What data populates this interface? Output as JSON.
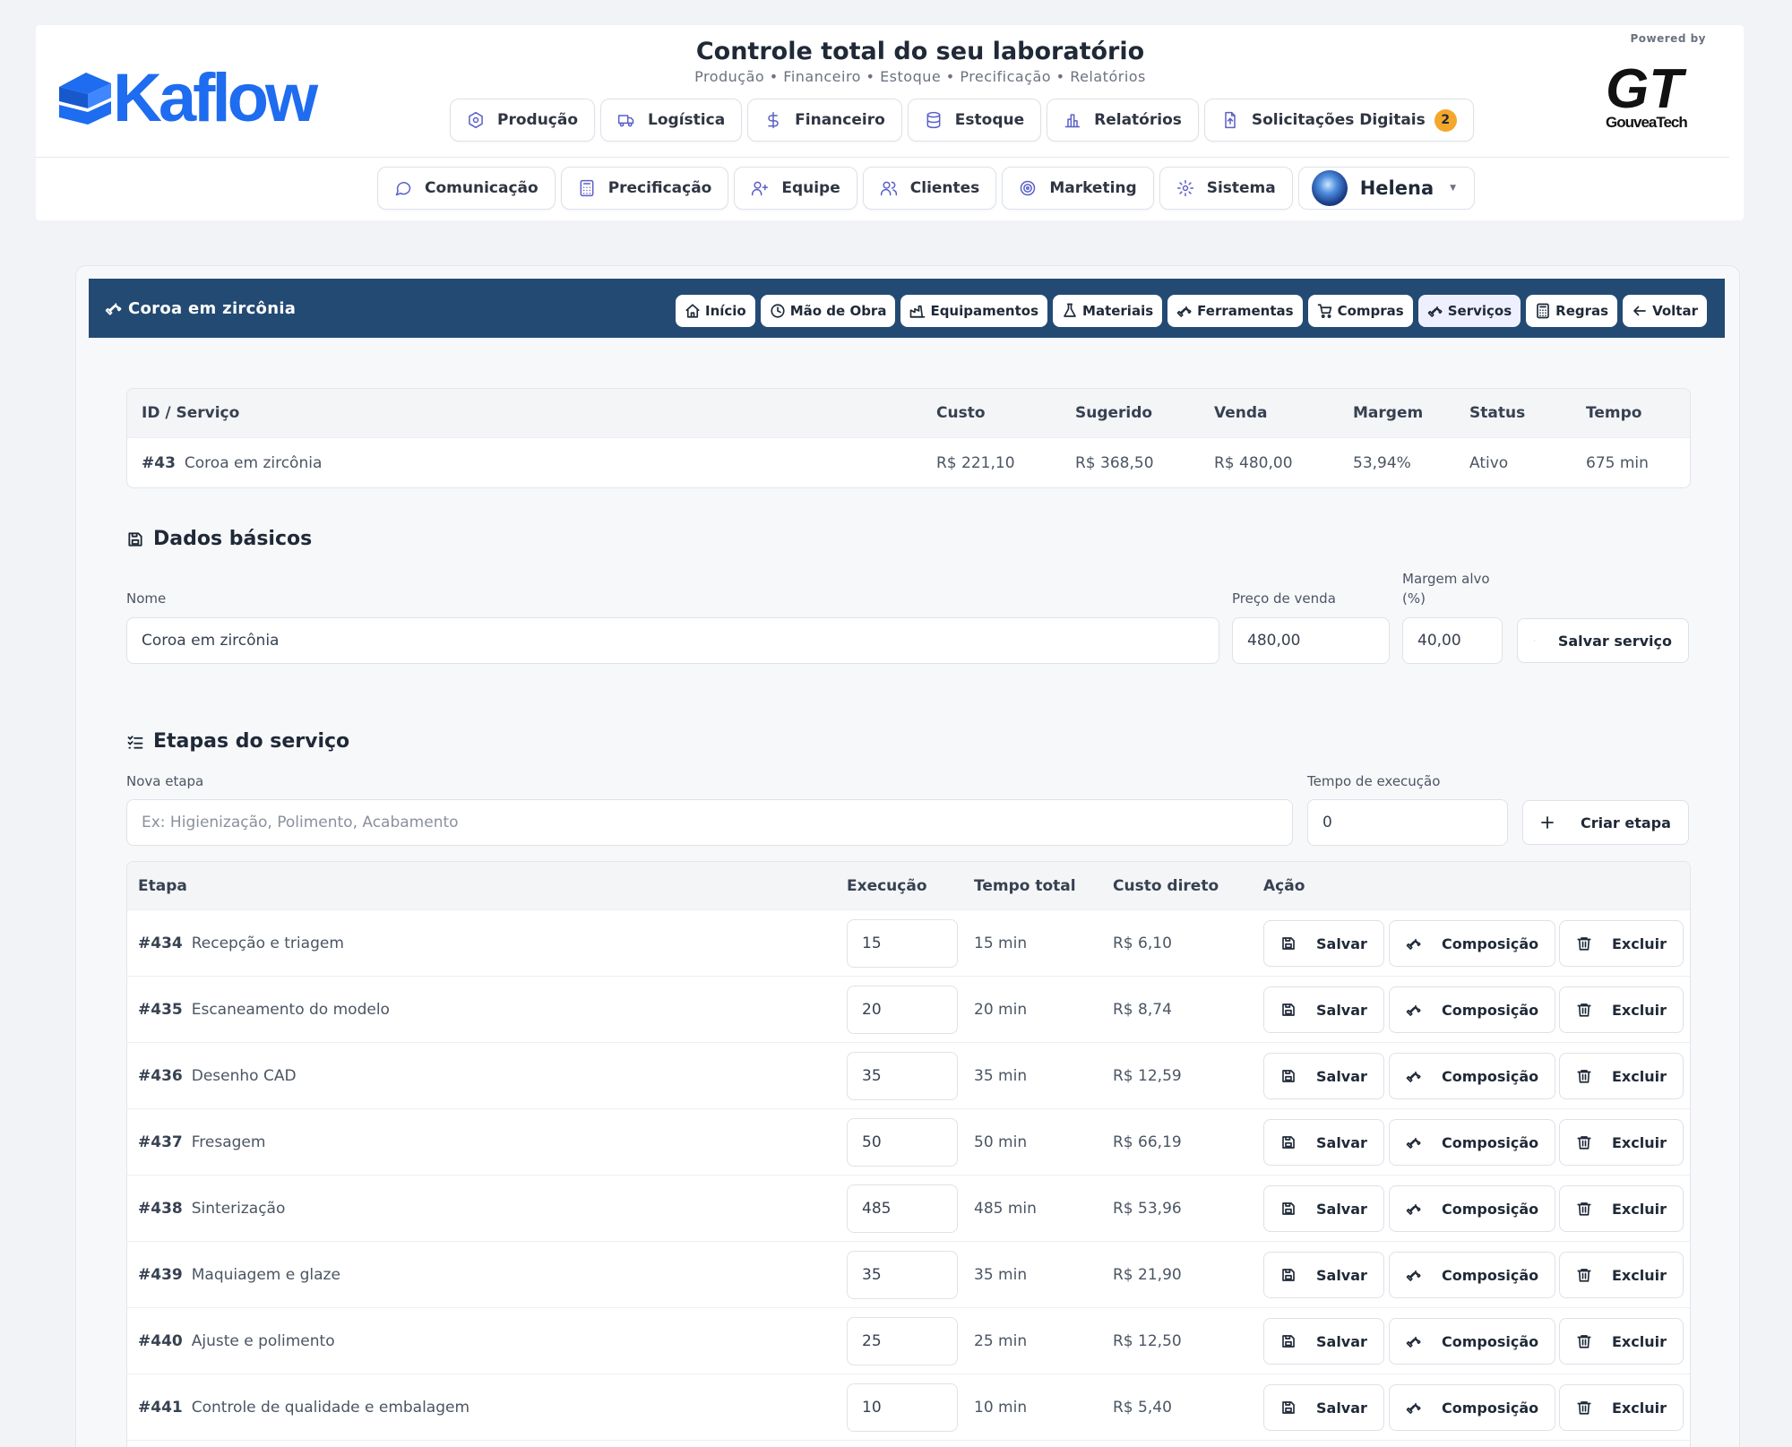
{
  "header": {
    "logo_text": "Kaflow",
    "title": "Controle total do seu laboratório",
    "subtitle": "Produção • Financeiro • Estoque • Precificação • Relatórios",
    "powered_by": "Powered by",
    "partner_logo": "GouveaTech"
  },
  "nav_primary": [
    {
      "label": "Produção",
      "icon": "hexagon-icon"
    },
    {
      "label": "Logística",
      "icon": "truck-icon"
    },
    {
      "label": "Financeiro",
      "icon": "dollar-icon"
    },
    {
      "label": "Estoque",
      "icon": "database-icon"
    },
    {
      "label": "Relatórios",
      "icon": "bar-chart-icon"
    },
    {
      "label": "Solicitações Digitais",
      "icon": "file-upload-icon",
      "badge": "2"
    }
  ],
  "nav_secondary": [
    {
      "label": "Comunicação",
      "icon": "message-icon"
    },
    {
      "label": "Precificação",
      "icon": "calculator-icon"
    },
    {
      "label": "Equipe",
      "icon": "user-plus-icon"
    },
    {
      "label": "Clientes",
      "icon": "users-icon"
    },
    {
      "label": "Marketing",
      "icon": "target-icon"
    },
    {
      "label": "Sistema",
      "icon": "gear-icon"
    }
  ],
  "user": {
    "name": "Helena"
  },
  "page": {
    "breadcrumb": "Coroa em zircônia",
    "tabs": [
      {
        "label": "Início",
        "icon": "home-icon"
      },
      {
        "label": "Mão de Obra",
        "icon": "clock-icon"
      },
      {
        "label": "Equipamentos",
        "icon": "factory-icon"
      },
      {
        "label": "Materiais",
        "icon": "flask-icon"
      },
      {
        "label": "Ferramentas",
        "icon": "wrench-icon"
      },
      {
        "label": "Compras",
        "icon": "cart-icon"
      },
      {
        "label": "Serviços",
        "icon": "wrench-icon",
        "active": true
      },
      {
        "label": "Regras",
        "icon": "calculator-icon"
      },
      {
        "label": "Voltar",
        "icon": "arrow-left-icon"
      }
    ]
  },
  "summary": {
    "headers": [
      "ID / Serviço",
      "Custo",
      "Sugerido",
      "Venda",
      "Margem",
      "Status",
      "Tempo"
    ],
    "row": {
      "id": "#43",
      "name": "Coroa em zircônia",
      "custo": "R$ 221,10",
      "sugerido": "R$ 368,50",
      "venda": "R$ 480,00",
      "margem": "53,94%",
      "status": "Ativo",
      "tempo": "675 min"
    }
  },
  "basic": {
    "heading": "Dados básicos",
    "name_label": "Nome",
    "name_value": "Coroa em zircônia",
    "price_label": "Preço de venda",
    "price_value": "480,00",
    "margin_label_1": "Margem alvo",
    "margin_label_2": "(%)",
    "margin_value": "40,00",
    "save_label": "Salvar serviço"
  },
  "steps_section": {
    "heading": "Etapas do serviço",
    "new_label": "Nova etapa",
    "new_placeholder": "Ex: Higienização, Polimento, Acabamento",
    "time_label": "Tempo de execução",
    "time_value": "0",
    "create_label": "Criar etapa"
  },
  "steps_table": {
    "headers": [
      "Etapa",
      "Execução",
      "Tempo total",
      "Custo direto",
      "Ação"
    ],
    "action_labels": {
      "save": "Salvar",
      "compose": "Composição",
      "delete": "Excluir"
    },
    "rows": [
      {
        "id": "#434",
        "name": "Recepção e triagem",
        "exec": "15",
        "total": "15 min",
        "cost": "R$ 6,10"
      },
      {
        "id": "#435",
        "name": "Escaneamento do modelo",
        "exec": "20",
        "total": "20 min",
        "cost": "R$ 8,74"
      },
      {
        "id": "#436",
        "name": "Desenho CAD",
        "exec": "35",
        "total": "35 min",
        "cost": "R$ 12,59"
      },
      {
        "id": "#437",
        "name": "Fresagem",
        "exec": "50",
        "total": "50 min",
        "cost": "R$ 66,19"
      },
      {
        "id": "#438",
        "name": "Sinterização",
        "exec": "485",
        "total": "485 min",
        "cost": "R$ 53,96"
      },
      {
        "id": "#439",
        "name": "Maquiagem e glaze",
        "exec": "35",
        "total": "35 min",
        "cost": "R$ 21,90"
      },
      {
        "id": "#440",
        "name": "Ajuste e polimento",
        "exec": "25",
        "total": "25 min",
        "cost": "R$ 12,50"
      },
      {
        "id": "#441",
        "name": "Controle de qualidade e embalagem",
        "exec": "10",
        "total": "10 min",
        "cost": "R$ 5,40"
      }
    ]
  },
  "colors": {
    "brand": "#1e6cf0",
    "titlebar": "#234a73",
    "badge": "#f4a72b",
    "nav_icon": "#5b5fc7"
  }
}
